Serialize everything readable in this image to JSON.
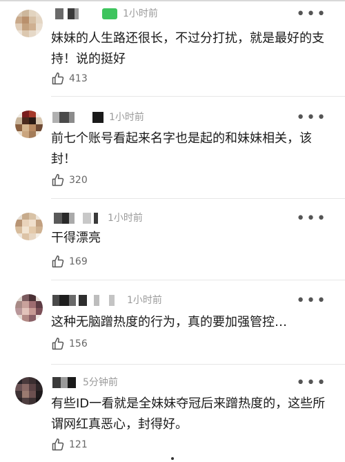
{
  "comments": [
    {
      "time": "1小时前",
      "text": "妹妹的人生路还很长，不过分打扰，就是最好的支持！说的挺好",
      "likes": "413"
    },
    {
      "time": "1小时前",
      "text": "前七个账号看起来名字也是起的和妹妹相关，该封！",
      "likes": "320"
    },
    {
      "time": "1小时前",
      "text": "干得漂亮",
      "likes": "169"
    },
    {
      "time": "1小时前",
      "text": "这种无脑蹭热度的行为，真的要加强管控…",
      "likes": "156"
    },
    {
      "time": "5分钟前",
      "text": "有些ID一看就是全妹妹夺冠后来蹭热度的，这些所谓网红真恶心，封得好。",
      "likes": "121"
    }
  ],
  "icons": {
    "more": "more-icon",
    "like": "thumbs-up-icon",
    "avatar": "avatar-pixelated"
  },
  "colors": {
    "badge_green": "#3ec45e",
    "time_gray": "#9a9a9a"
  }
}
